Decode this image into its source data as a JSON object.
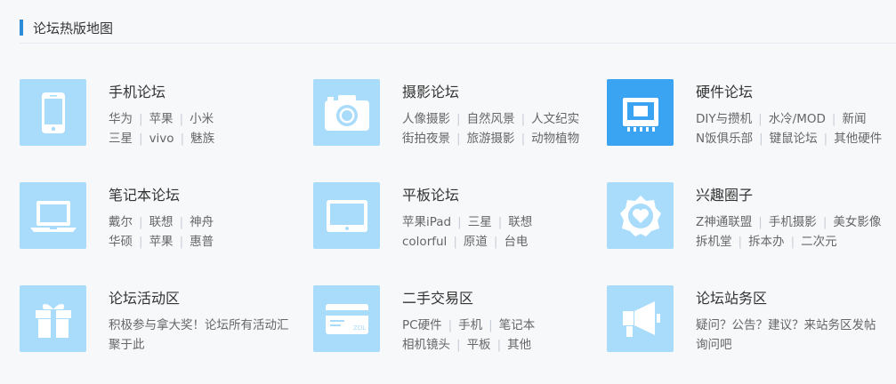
{
  "header": {
    "title": "论坛热版地图"
  },
  "cards": [
    {
      "name": "手机论坛",
      "icon": "phone-icon",
      "lines": [
        [
          "华为",
          "苹果",
          "小米"
        ],
        [
          "三星",
          "vivo",
          "魅族"
        ]
      ]
    },
    {
      "name": "摄影论坛",
      "icon": "camera-icon",
      "lines": [
        [
          "人像摄影",
          "自然风景",
          "人文纪实"
        ],
        [
          "街拍夜景",
          "旅游摄影",
          "动物植物"
        ]
      ]
    },
    {
      "name": "硬件论坛",
      "icon": "chip-icon",
      "active": true,
      "lines": [
        [
          "DIY与攒机",
          "水冷/MOD",
          "新闻"
        ],
        [
          "N饭俱乐部",
          "键鼠论坛",
          "其他硬件"
        ]
      ]
    },
    {
      "name": "笔记本论坛",
      "icon": "laptop-icon",
      "lines": [
        [
          "戴尔",
          "联想",
          "神舟"
        ],
        [
          "华硕",
          "苹果",
          "惠普"
        ]
      ]
    },
    {
      "name": "平板论坛",
      "icon": "tablet-icon",
      "lines": [
        [
          "苹果iPad",
          "三星",
          "联想"
        ],
        [
          "colorful",
          "原道",
          "台电"
        ]
      ]
    },
    {
      "name": "兴趣圈子",
      "icon": "heart-badge-icon",
      "lines": [
        [
          "Z神通联盟",
          "手机摄影",
          "美女影像"
        ],
        [
          "拆机堂",
          "拆本办",
          "二次元"
        ]
      ]
    },
    {
      "name": "论坛活动区",
      "icon": "gift-icon",
      "desc": "积极参与拿大奖！论坛所有活动汇聚于此"
    },
    {
      "name": "二手交易区",
      "icon": "card-icon",
      "icon_label": "ZOL",
      "lines": [
        [
          "PC硬件",
          "手机",
          "笔记本"
        ],
        [
          "相机镜头",
          "平板",
          "其他"
        ]
      ]
    },
    {
      "name": "论坛站务区",
      "icon": "megaphone-icon",
      "desc": "疑问？公告？建议？来站务区发帖询问吧"
    }
  ],
  "colors": {
    "accent": "#2d8cd8",
    "icon_bg": "#a9dbfb",
    "icon_bg_active": "#3aa3f2"
  }
}
